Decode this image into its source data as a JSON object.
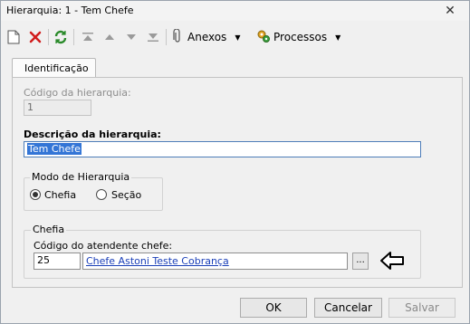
{
  "window": {
    "title": "Hierarquia: 1 - Tem Chefe",
    "close_glyph": "✕"
  },
  "toolbar": {
    "new_icon": "new-document-icon",
    "delete_icon": "delete-icon",
    "refresh_icon": "refresh-icon",
    "first_icon": "first-record-icon",
    "prev_icon": "previous-record-icon",
    "next_icon": "next-record-icon",
    "last_icon": "last-record-icon",
    "anexos_label": "Anexos",
    "processos_label": "Processos"
  },
  "tabs": [
    {
      "label": "Identificação"
    }
  ],
  "form": {
    "codigo_label": "Código da hierarquia:",
    "codigo_value": "1",
    "descricao_label": "Descrição da hierarquia:",
    "descricao_value": "Tem Chefe",
    "modo_title": "Modo de Hierarquia",
    "modo_options": [
      {
        "label": "Chefia",
        "selected": true
      },
      {
        "label": "Seção",
        "selected": false
      }
    ],
    "chefia_title": "Chefia",
    "atendente_label": "Código do atendente chefe:",
    "atendente_code": "25",
    "atendente_name": "Chefe Astoni Teste Cobrança",
    "lookup_label": "..."
  },
  "buttons": {
    "ok": "OK",
    "cancelar": "Cancelar",
    "salvar": "Salvar"
  },
  "colors": {
    "accent": "#3375d6",
    "link": "#1a3fb8",
    "delete": "#d11c1c",
    "refresh": "#2a8a2a"
  }
}
